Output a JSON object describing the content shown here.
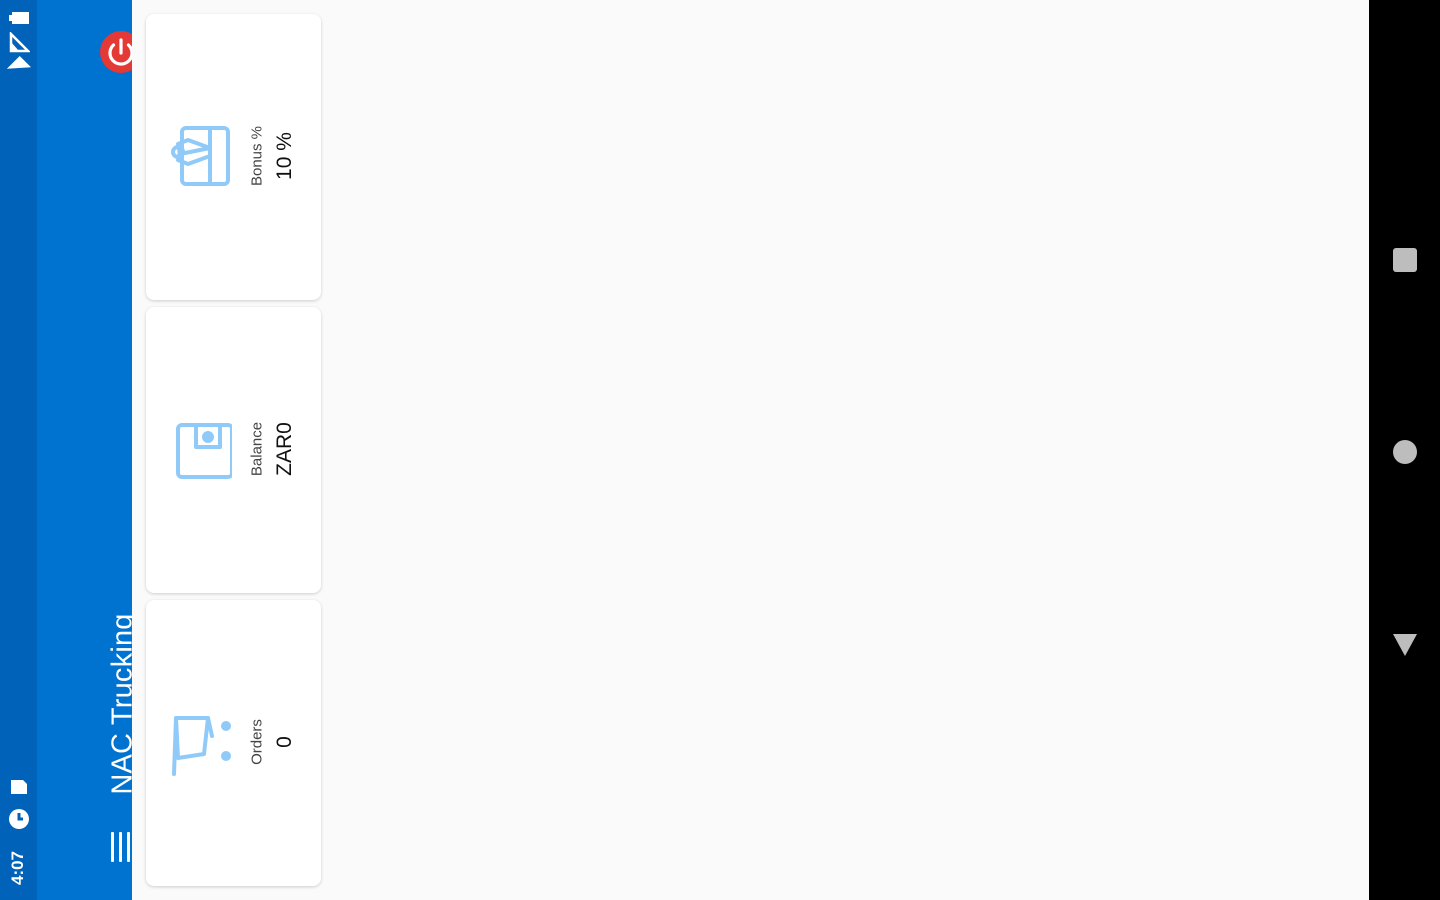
{
  "status_bar": {
    "time": "4:07",
    "icons": [
      "wifi-icon",
      "signal-icon",
      "battery-icon",
      "sync-icon",
      "sd-card-icon"
    ]
  },
  "toolbar": {
    "title": "NAC Trucking",
    "menu_icon": "hamburger-menu-icon",
    "logout_icon": "power-icon",
    "color": "#0072d0",
    "logout_color": "#e53935"
  },
  "cards": [
    {
      "label": "Bonus %",
      "value": "10 %",
      "icon": "gift-card-icon"
    },
    {
      "label": "Balance",
      "value": "ZAR0",
      "icon": "wallet-icon"
    },
    {
      "label": "Orders",
      "value": "0",
      "icon": "shopping-cart-icon"
    }
  ],
  "icon_color": "#90caf9",
  "nav_bar": {
    "buttons": [
      "recents-button",
      "home-button",
      "back-button"
    ]
  }
}
